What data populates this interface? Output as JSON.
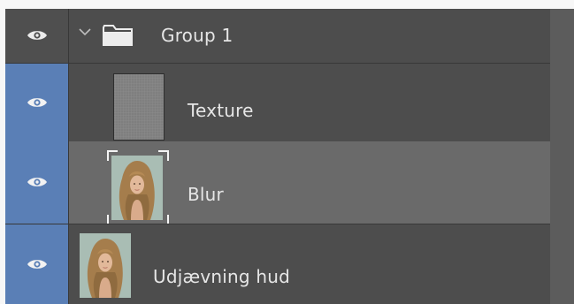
{
  "layers_panel": {
    "group": {
      "name": "Group 1",
      "expanded": true,
      "visible": true,
      "icon": "folder-icon"
    },
    "layers": [
      {
        "key": "texture",
        "name": "Texture",
        "visible": true,
        "thumbnail": "gray-texture-thumbnail",
        "selected": false
      },
      {
        "key": "blur",
        "name": "Blur",
        "visible": true,
        "thumbnail": "portrait-thumbnail",
        "selected": true
      },
      {
        "key": "hud",
        "name": "Udjævning hud",
        "visible": true,
        "thumbnail": "portrait-thumbnail",
        "selected": false
      }
    ]
  },
  "colors": {
    "panel_background": "#4d4d4d",
    "selected_row": "#6a6a6a",
    "visibility_cell_active": "#5a7fb6",
    "text": "#e6e6e6"
  }
}
